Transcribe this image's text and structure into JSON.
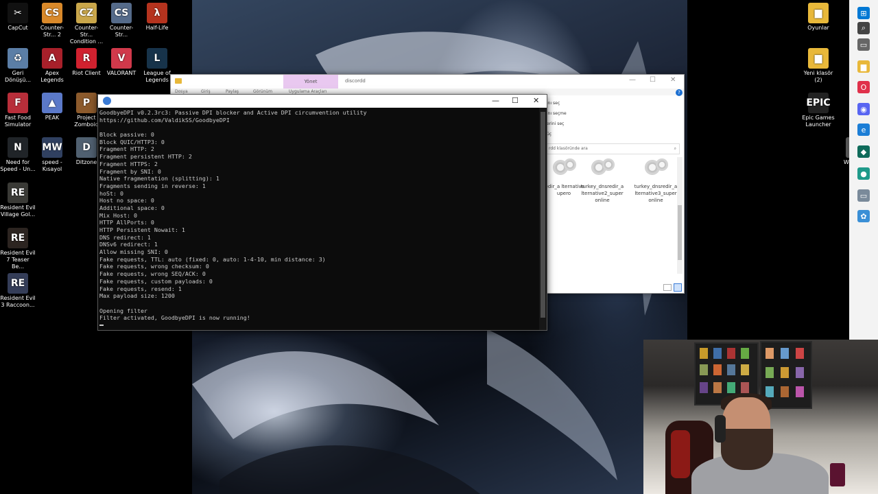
{
  "desktop_icons": [
    {
      "label": "CapCut",
      "color": "#111111",
      "glyph": "✂"
    },
    {
      "label": "Counter-Str... 2",
      "color": "#d9892a",
      "glyph": "CS"
    },
    {
      "label": "Counter-Str... Condition ...",
      "color": "#c9a64a",
      "glyph": "CZ"
    },
    {
      "label": "Counter-Str...",
      "color": "#556b8a",
      "glyph": "CS"
    },
    {
      "label": "Half-Life",
      "color": "#b5331e",
      "glyph": "λ"
    },
    {
      "label": "Geri Dönüşü...",
      "color": "#5b7ea6",
      "glyph": "♻"
    },
    {
      "label": "Apex Legends",
      "color": "#a8202a",
      "glyph": "A"
    },
    {
      "label": "Riot Client",
      "color": "#d0212f",
      "glyph": "R"
    },
    {
      "label": "VALORANT",
      "color": "#d1394b",
      "glyph": "V"
    },
    {
      "label": "League of Legends",
      "color": "#17334a",
      "glyph": "L"
    },
    {
      "label": "Fast Food Simulator",
      "color": "#b82e3a",
      "glyph": "F"
    },
    {
      "label": "PEAK",
      "color": "#5b79c9",
      "glyph": "▲"
    },
    {
      "label": "Project Zomboid",
      "color": "#8c5a2c",
      "glyph": "P"
    },
    {
      "label": "Need for Speed - Un...",
      "color": "#202428",
      "glyph": "N"
    },
    {
      "label": "speed - Kısayol",
      "color": "#304060",
      "glyph": "MW"
    },
    {
      "label": "Ditzone",
      "color": "#506070",
      "glyph": "D"
    },
    {
      "label": "Resident Evil Village Gol...",
      "color": "#3a3a36",
      "glyph": "RE"
    },
    {
      "label": "Resident Evil 7 Teaser Be...",
      "color": "#2c2420",
      "glyph": "RE"
    },
    {
      "label": "Resident Evil 3 Raccoon...",
      "color": "#343d58",
      "glyph": "RE"
    },
    {
      "label": "Oyunlar",
      "color": "#e8b83a",
      "glyph": "▆"
    },
    {
      "label": "Yeni klasör (2)",
      "color": "#e8b83a",
      "glyph": "▆"
    },
    {
      "label": "Epic Games Launcher",
      "color": "#222222",
      "glyph": "EPIC"
    },
    {
      "label": "Won Film",
      "color": "#555555",
      "glyph": ""
    }
  ],
  "console": {
    "title_icon": "goodbyedpi-icon",
    "controls": {
      "minimize": "—",
      "maximize": "☐",
      "close": "✕"
    },
    "lines": [
      "GoodbyeDPI v0.2.3rc3: Passive DPI blocker and Active DPI circumvention utility",
      "https://github.com/ValdikSS/GoodbyeDPI",
      "",
      "Block passive: 0",
      "Block QUIC/HTTP3: 0",
      "Fragment HTTP: 2",
      "Fragment persistent HTTP: 2",
      "Fragment HTTPS: 2",
      "Fragment by SNI: 0",
      "Native fragmentation (splitting): 1",
      "Fragments sending in reverse: 1",
      "hoSt: 0",
      "Host no space: 0",
      "Additional space: 0",
      "Mix Host: 0",
      "HTTP AllPorts: 0",
      "HTTP Persistent Nowait: 1",
      "DNS redirect: 1",
      "DNSv6 redirect: 1",
      "Allow missing SNI: 0",
      "Fake requests, TTL: auto (fixed: 0, auto: 1-4-10, min distance: 3)",
      "Fake requests, wrong checksum: 0",
      "Fake requests, wrong SEQ/ACK: 0",
      "Fake requests, custom payloads: 0",
      "Fake requests, resend: 1",
      "Max payload size: 1200",
      "",
      "Opening filter",
      "Filter activated, GoodbyeDPI is now running!"
    ]
  },
  "explorer": {
    "manage_tab": "Yönet",
    "folder_name": "discordd",
    "ribbon": [
      "Dosya",
      "Giriş",
      "Paylaş",
      "Görünüm",
      "Uygulama Araçları"
    ],
    "side_items": [
      "ını seç",
      "inı seçme",
      "erini seç",
      "üç"
    ],
    "search_placeholder": "rdd klasöründe ara",
    "files": [
      "redir_a lternative upero",
      "turkey_dnsredir_a lternative2_super online",
      "turkey_dnsredir_a lternative3_super online"
    ]
  },
  "taskbar": {
    "items": [
      {
        "name": "windows-start-icon",
        "color": "#0078d4",
        "glyph": "⊞"
      },
      {
        "name": "search-icon",
        "color": "#444444",
        "glyph": "⌕"
      },
      {
        "name": "task-view-icon",
        "color": "#666666",
        "glyph": "▭"
      },
      {
        "name": "file-explorer-icon",
        "color": "#e8b83a",
        "glyph": "▆"
      },
      {
        "name": "opera-gx-icon",
        "color": "#e0314b",
        "glyph": "O"
      },
      {
        "name": "discord-icon",
        "color": "#5865f2",
        "glyph": "◉"
      },
      {
        "name": "edge-icon",
        "color": "#1c7ed6",
        "glyph": "e"
      },
      {
        "name": "league-icon",
        "color": "#0f6b5a",
        "glyph": "◆"
      },
      {
        "name": "webcam-app-icon",
        "color": "#1f9a8a",
        "glyph": "●"
      },
      {
        "name": "window-icon",
        "color": "#7a8a9a",
        "glyph": "▭"
      },
      {
        "name": "settings-app-icon",
        "color": "#3a8fd6",
        "glyph": "✿"
      }
    ]
  }
}
